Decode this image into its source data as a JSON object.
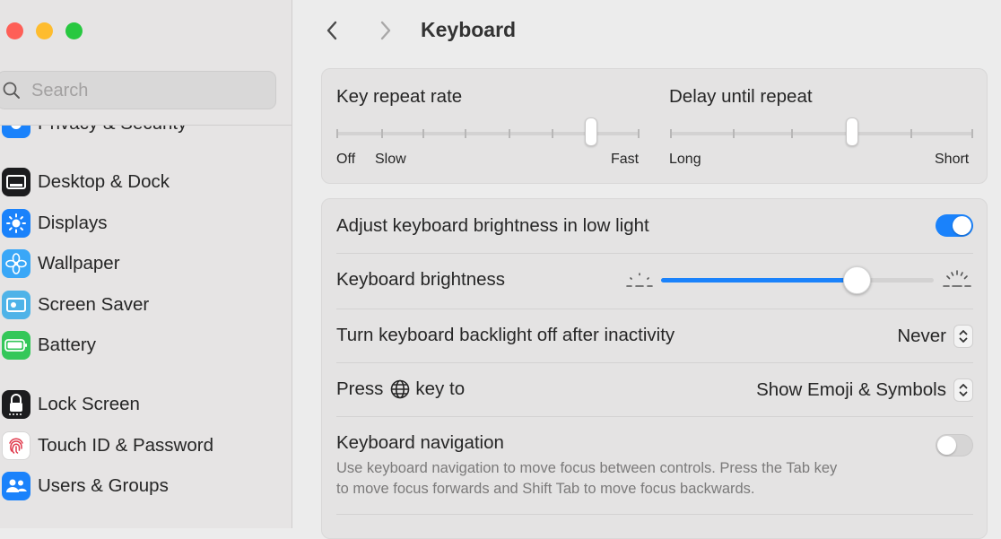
{
  "window": {
    "title": "Keyboard",
    "traffic_lights": {
      "close": "#fe5f57",
      "minimize": "#febc2e",
      "zoom": "#28c840"
    }
  },
  "sidebar": {
    "search_placeholder": "Search",
    "items": [
      {
        "label": "Privacy & Security",
        "icon": "hand-icon",
        "color": "#1a82fb"
      },
      {
        "label": "Desktop & Dock",
        "icon": "dock-icon",
        "color": "#1c1c1e"
      },
      {
        "label": "Displays",
        "icon": "sun-icon",
        "color": "#1a82fb"
      },
      {
        "label": "Wallpaper",
        "icon": "flower-icon",
        "color": "#3aa7f7"
      },
      {
        "label": "Screen Saver",
        "icon": "screen-saver-icon",
        "color": "#4fb3e8"
      },
      {
        "label": "Battery",
        "icon": "battery-icon",
        "color": "#34c759"
      },
      {
        "label": "Lock Screen",
        "icon": "lock-icon",
        "color": "#1c1c1e"
      },
      {
        "label": "Touch ID & Password",
        "icon": "fingerprint-icon",
        "color": "#ffffff"
      },
      {
        "label": "Users & Groups",
        "icon": "users-icon",
        "color": "#1a82fb"
      }
    ]
  },
  "header": {
    "title": "Keyboard"
  },
  "key_repeat": {
    "title": "Key repeat rate",
    "labels": {
      "off": "Off",
      "slow": "Slow",
      "fast": "Fast"
    },
    "value_fraction": 0.84
  },
  "delay_repeat": {
    "title": "Delay until repeat",
    "labels": {
      "long": "Long",
      "short": "Short"
    },
    "value_fraction": 0.6
  },
  "settings": {
    "adjust_brightness": {
      "label": "Adjust keyboard brightness in low light",
      "enabled": true
    },
    "keyboard_brightness": {
      "label": "Keyboard brightness",
      "value_fraction": 0.72
    },
    "backlight_off": {
      "label": "Turn keyboard backlight off after inactivity",
      "value": "Never"
    },
    "press_key": {
      "label_before": "Press",
      "label_after": "key to",
      "key_icon": "globe-icon",
      "value": "Show Emoji & Symbols"
    },
    "keyboard_navigation": {
      "label": "Keyboard navigation",
      "enabled": false,
      "description_line1": "Use keyboard navigation to move focus between controls. Press the Tab key",
      "description_line2": "to move focus forwards and Shift Tab to move focus backwards."
    }
  },
  "colors": {
    "accent": "#1a82fb",
    "background": "#ececec",
    "sidebar": "#e6e4e4"
  }
}
